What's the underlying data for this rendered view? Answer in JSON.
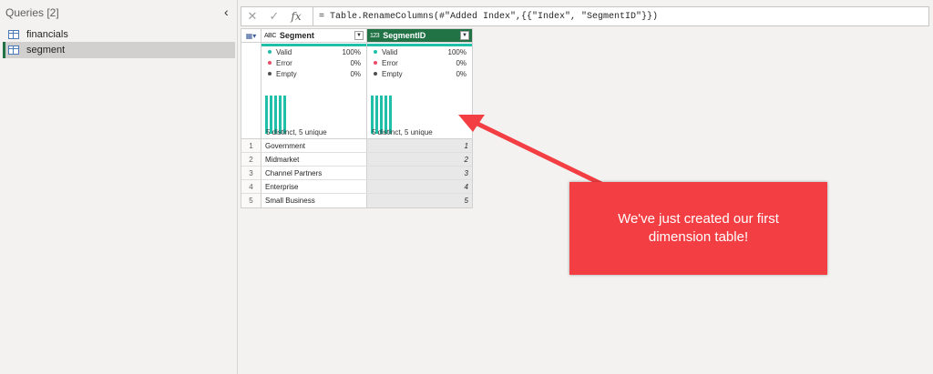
{
  "queries": {
    "title": "Queries [2]",
    "items": [
      {
        "label": "financials",
        "selected": false
      },
      {
        "label": "segment",
        "selected": true
      }
    ]
  },
  "formula": {
    "cancel": "✕",
    "commit": "✓",
    "fx": "fx",
    "text": "= Table.RenameColumns(#\"Added Index\",{{\"Index\", \"SegmentID\"}})"
  },
  "grid": {
    "columns": [
      {
        "name": "Segment",
        "type_icon": "ABC"
      },
      {
        "name": "SegmentID",
        "type_icon": "123"
      }
    ],
    "profile": {
      "segment": {
        "valid_label": "Valid",
        "valid": "100%",
        "error_label": "Error",
        "error": "0%",
        "empty_label": "Empty",
        "empty": "0%",
        "distinct": "5 distinct, 5 unique"
      },
      "segmentid": {
        "valid_label": "Valid",
        "valid": "100%",
        "error_label": "Error",
        "error": "0%",
        "empty_label": "Empty",
        "empty": "0%",
        "distinct": "5 distinct, 5 unique"
      }
    },
    "rows": [
      {
        "n": "1",
        "segment": "Government",
        "id": "1"
      },
      {
        "n": "2",
        "segment": "Midmarket",
        "id": "2"
      },
      {
        "n": "3",
        "segment": "Channel Partners",
        "id": "3"
      },
      {
        "n": "4",
        "segment": "Enterprise",
        "id": "4"
      },
      {
        "n": "5",
        "segment": "Small Business",
        "id": "5"
      }
    ]
  },
  "callout": {
    "text": "We've just created our first dimension table!"
  },
  "colors": {
    "accent": "#217346",
    "quality": "#1fbfa9",
    "callout": "#f33f43",
    "error_dot": "#e84c6a",
    "empty_dot": "#4f4f4f"
  }
}
